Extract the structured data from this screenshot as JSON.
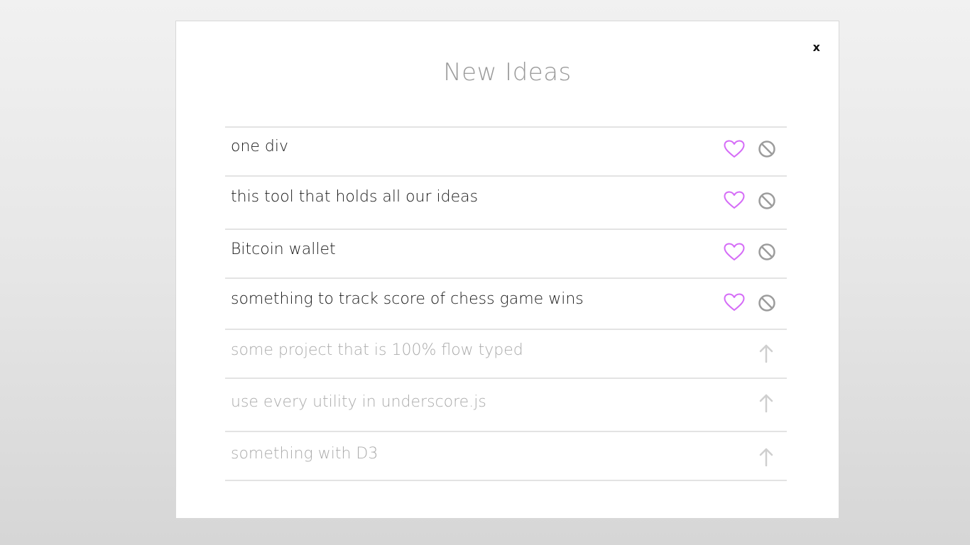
{
  "modal": {
    "title": "New Ideas",
    "close_label": "x"
  },
  "colors": {
    "heart": "#d56cf7",
    "block": "#9c9c9c",
    "upvote": "#cfcfcf",
    "active_text": "#1a1a1a",
    "archived_text": "#ababab"
  },
  "ideas": [
    {
      "text": "one div",
      "status": "active",
      "actions": [
        "heart-icon",
        "block-icon"
      ]
    },
    {
      "text": "this tool that holds all our ideas",
      "status": "active",
      "actions": [
        "heart-icon",
        "block-icon"
      ]
    },
    {
      "text": "Bitcoin wallet",
      "status": "active",
      "actions": [
        "heart-icon",
        "block-icon"
      ]
    },
    {
      "text": "something to track score of chess game wins",
      "status": "active",
      "actions": [
        "heart-icon",
        "block-icon"
      ]
    },
    {
      "text": "some project that is 100% flow typed",
      "status": "archived",
      "actions": [
        "arrow-up-icon"
      ]
    },
    {
      "text": "use every utility in underscore.js",
      "status": "archived",
      "actions": [
        "arrow-up-icon"
      ]
    },
    {
      "text": "something with D3",
      "status": "archived",
      "actions": [
        "arrow-up-icon"
      ]
    }
  ]
}
